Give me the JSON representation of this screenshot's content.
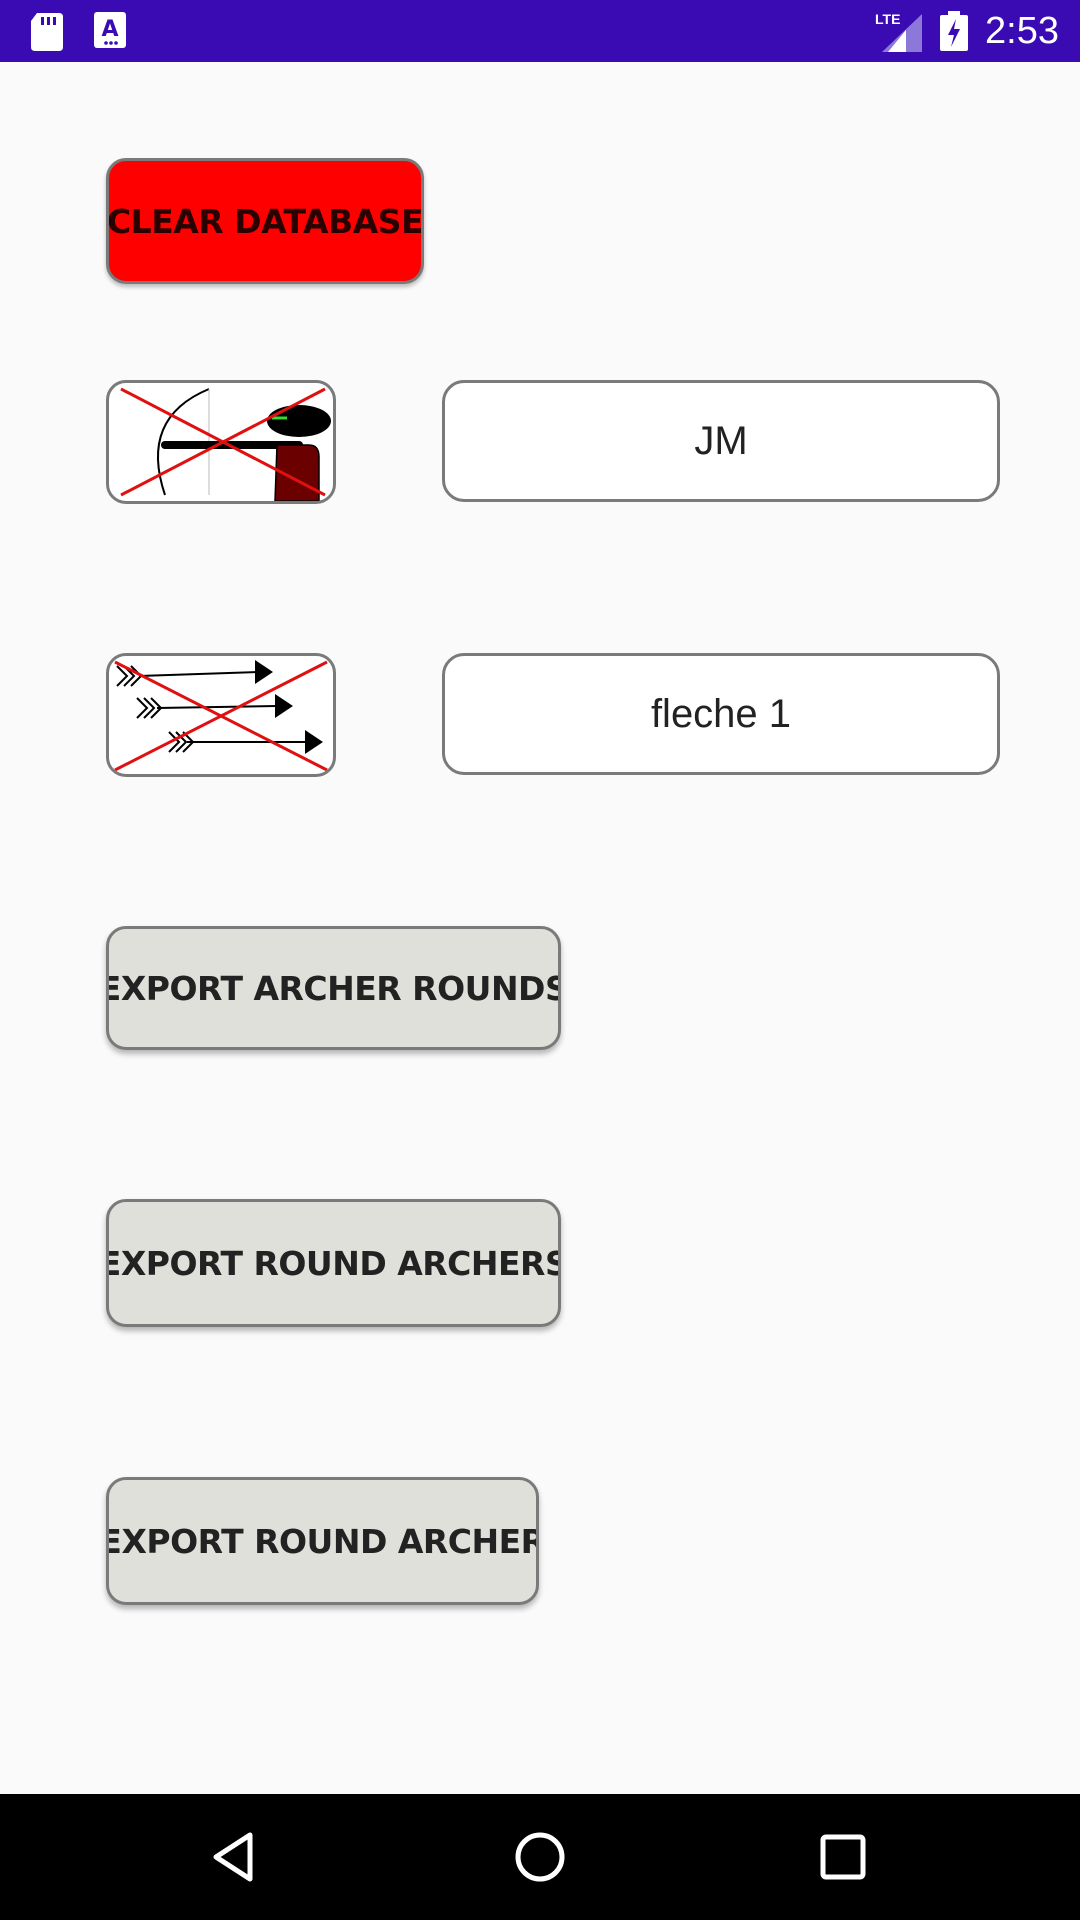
{
  "status_bar": {
    "time": "2:53",
    "network_label": "LTE",
    "icons": [
      "sd-card-icon",
      "font-a-icon",
      "lte-signal-icon",
      "battery-charging-icon"
    ]
  },
  "actions": {
    "clear_database_label": "CLEAR DATABASE",
    "export_archer_rounds_label": "EXPORT ARCHER ROUNDS",
    "export_round_archers_label": "EXPORT ROUND ARCHERS",
    "export_round_archer_label": "EXPORT ROUND ARCHER"
  },
  "archer": {
    "icon": "delete-archer-icon",
    "value": "JM"
  },
  "arrow_set": {
    "icon": "delete-arrows-icon",
    "value": "fleche 1"
  },
  "nav_bar": {
    "icons": [
      "back-icon",
      "home-icon",
      "recents-icon"
    ]
  },
  "colors": {
    "status_bar": "#3a0ab3",
    "clear_button": "#ff0000",
    "export_button": "#e0e0db",
    "cross_out": "#e01010",
    "archer_body": "#6b0000"
  }
}
